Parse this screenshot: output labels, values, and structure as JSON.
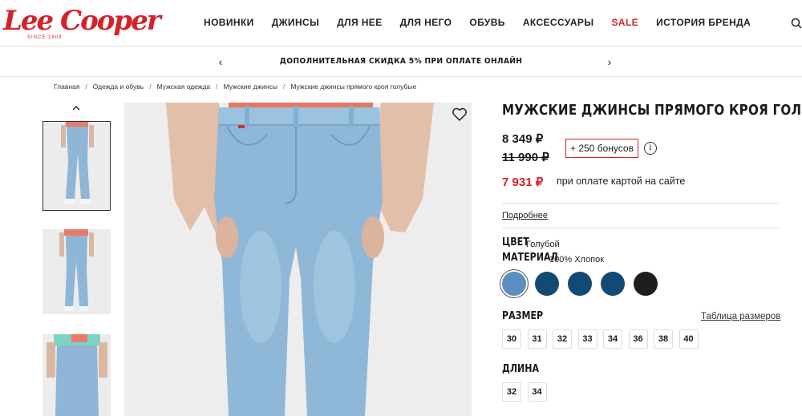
{
  "brand": {
    "name": "Lee Cooper",
    "tagline": "SINCE 1908"
  },
  "nav": [
    "НОВИНКИ",
    "ДЖИНСЫ",
    "ДЛЯ НЕЕ",
    "ДЛЯ НЕГО",
    "ОБУВЬ",
    "АКСЕССУАРЫ",
    "SALE",
    "ИСТОРИЯ БРЕНДА"
  ],
  "promo": {
    "text": "ДОПОЛНИТЕЛЬНАЯ СКИДКА 5% ПРИ ОПЛАТЕ ОНЛАЙН",
    "prev": "‹",
    "next": "›"
  },
  "breadcrumb": [
    "Главная",
    "Одежда и обувь",
    "Мужская одежда",
    "Мужские джинсы",
    "Мужские джинсы прямого кроя голубые"
  ],
  "product": {
    "title": "МУЖСКИЕ ДЖИНСЫ ПРЯМОГО КРОЯ ГОЛУБЫЕ",
    "price": "8 349 ₽",
    "old_price": "11 990 ₽",
    "bonus": "+ 250 бонусов",
    "info": "i",
    "card_price": "7 931 ₽",
    "card_note": "при оплате картой на сайте",
    "details_link": "Подробнее",
    "color_label": "ЦВЕТ",
    "color_value": "Голубой",
    "material_label": "МАТЕРИАЛ",
    "material_value": "100% Хлопок",
    "swatches": [
      "#5b8fc0",
      "#134a74",
      "#134a74",
      "#134a74",
      "#1e1e1e"
    ],
    "selected_swatch_index": 0,
    "size_label": "РАЗМЕР",
    "size_table_link": "Таблица размеров",
    "sizes": [
      "30",
      "31",
      "32",
      "33",
      "34",
      "36",
      "38",
      "40"
    ],
    "length_label": "ДЛИНА",
    "lengths": [
      "32",
      "34"
    ]
  },
  "colors": {
    "accent": "#d2232a",
    "denim": "#8fb8d8"
  }
}
